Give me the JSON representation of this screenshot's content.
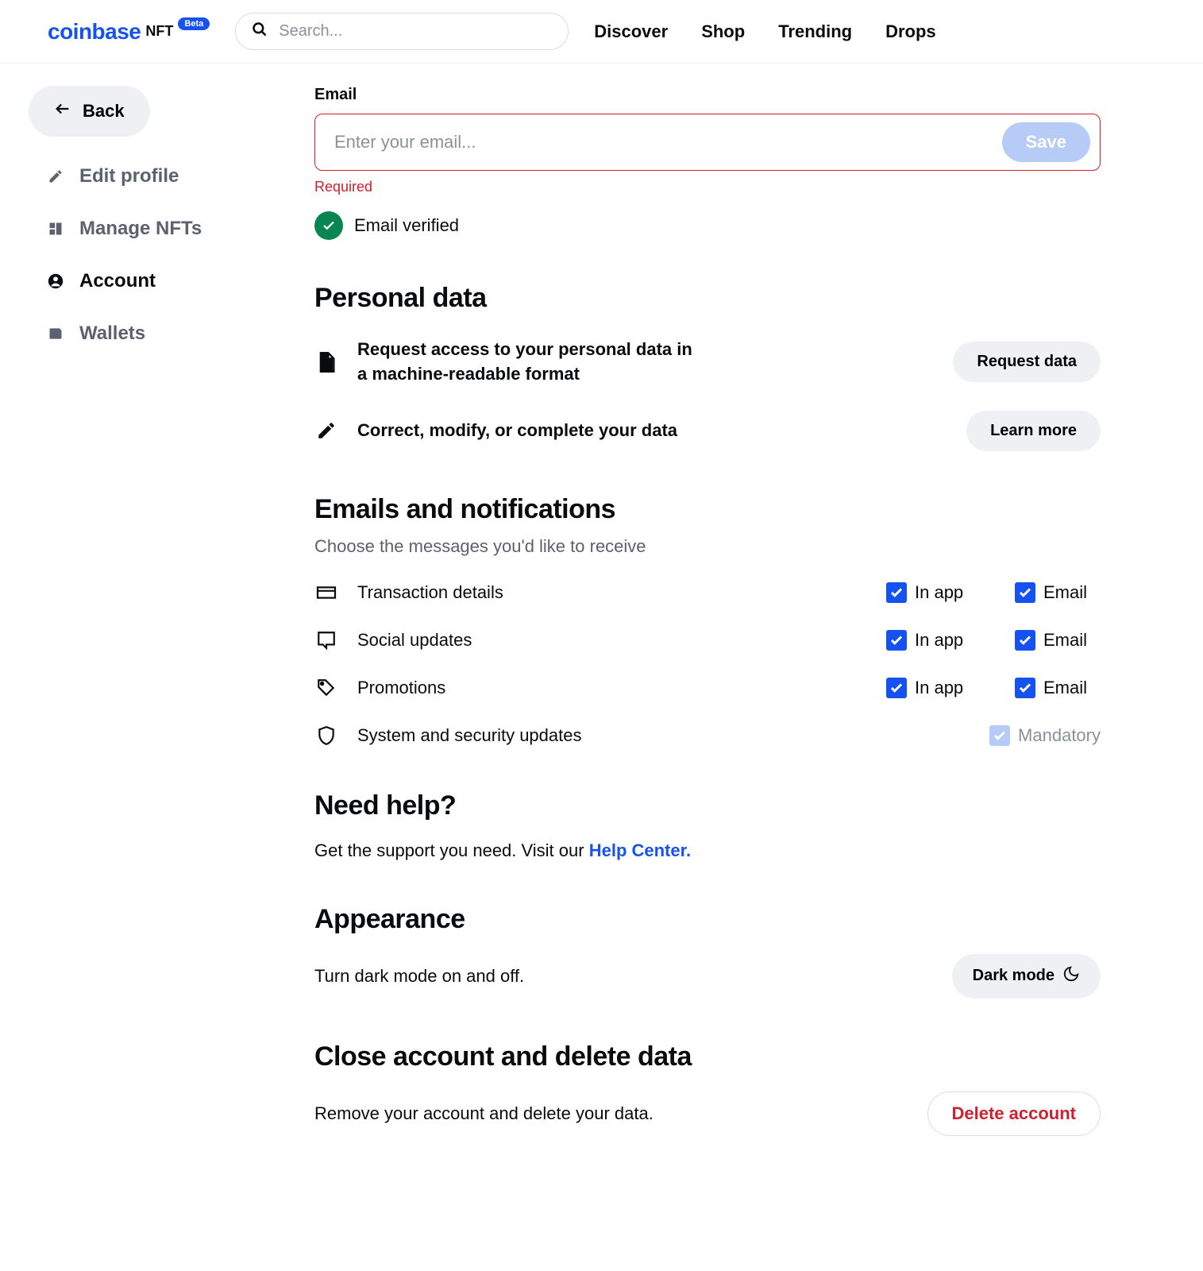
{
  "header": {
    "logo": "coinbase",
    "logo_suffix": "NFT",
    "beta": "Beta",
    "search_placeholder": "Search...",
    "nav": [
      "Discover",
      "Shop",
      "Trending",
      "Drops"
    ]
  },
  "sidebar": {
    "back": "Back",
    "items": [
      {
        "label": "Edit profile",
        "active": false
      },
      {
        "label": "Manage NFTs",
        "active": false
      },
      {
        "label": "Account",
        "active": true
      },
      {
        "label": "Wallets",
        "active": false
      }
    ]
  },
  "email": {
    "label": "Email",
    "placeholder": "Enter your email...",
    "save": "Save",
    "required": "Required",
    "verified": "Email verified"
  },
  "personal": {
    "heading": "Personal data",
    "row1_text": "Request access to your personal data in a machine-readable format",
    "row1_btn": "Request data",
    "row2_text": "Correct, modify, or complete your data",
    "row2_btn": "Learn more"
  },
  "notifications": {
    "heading": "Emails and notifications",
    "sub": "Choose the messages you'd like to receive",
    "inapp_label": "In app",
    "email_label": "Email",
    "mandatory_label": "Mandatory",
    "rows": [
      {
        "label": "Transaction details"
      },
      {
        "label": "Social updates"
      },
      {
        "label": "Promotions"
      },
      {
        "label": "System and security updates"
      }
    ]
  },
  "help": {
    "heading": "Need help?",
    "text": "Get the support you need. Visit our ",
    "link": "Help Center."
  },
  "appearance": {
    "heading": "Appearance",
    "text": "Turn dark mode on and off.",
    "btn": "Dark mode"
  },
  "close": {
    "heading": "Close account and delete data",
    "text": "Remove your account and delete your data.",
    "btn": "Delete account"
  }
}
